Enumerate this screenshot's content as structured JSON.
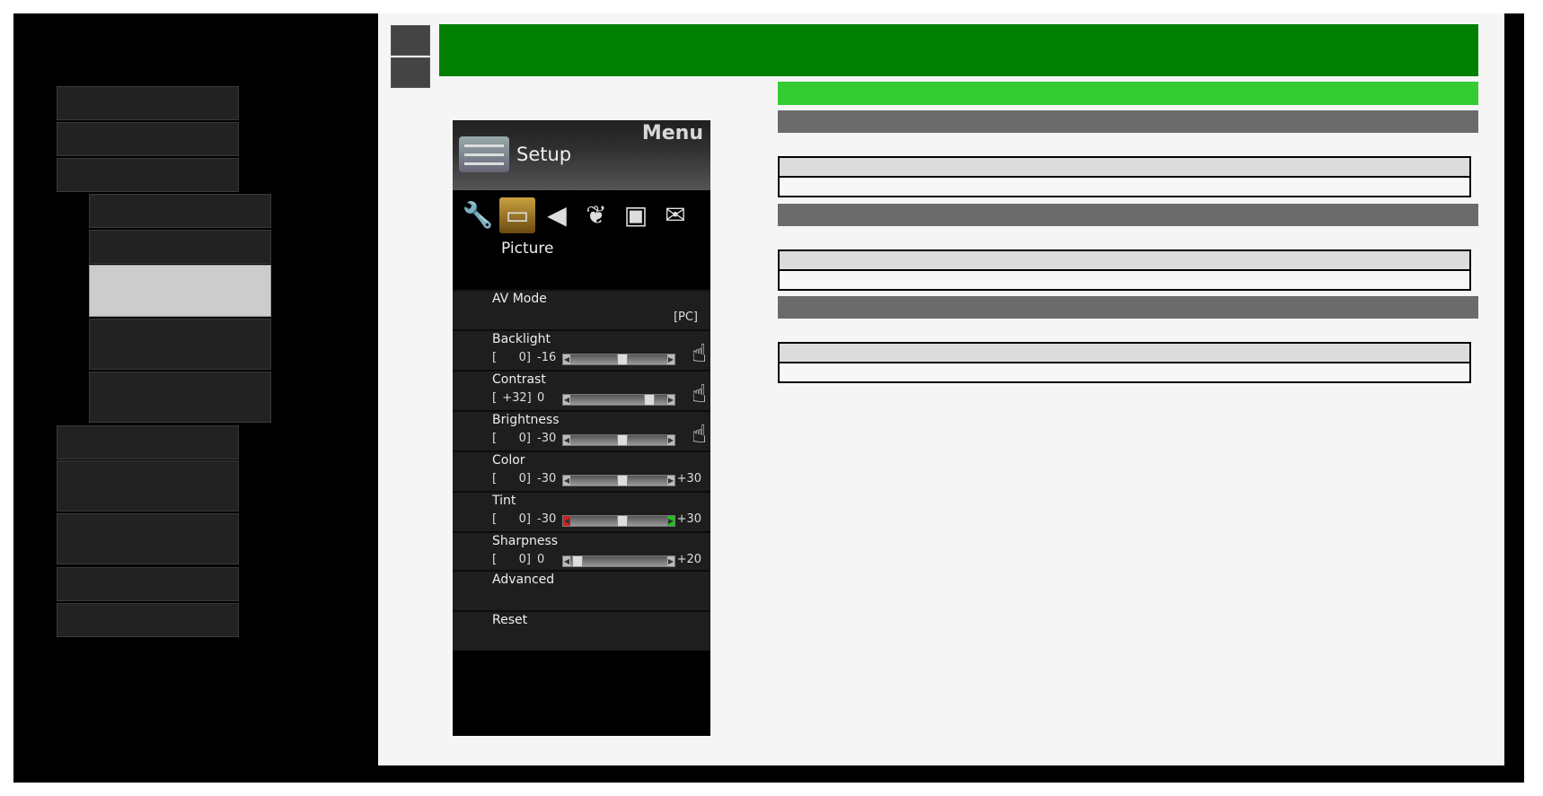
{
  "tv_menu": {
    "menu_title": "Menu",
    "setup_label": "Setup",
    "categories": [
      {
        "icon": "wrench-icon",
        "glyph": "🔧"
      },
      {
        "icon": "picture-icon",
        "glyph": "▭"
      },
      {
        "icon": "speaker-icon",
        "glyph": "◀"
      },
      {
        "icon": "leaf-icon",
        "glyph": "❦"
      },
      {
        "icon": "toolbox-icon",
        "glyph": "▣"
      },
      {
        "icon": "mail-icon",
        "glyph": "✉"
      }
    ],
    "category_label": "Picture",
    "av_mode": {
      "name": "AV Mode",
      "value": "[PC]"
    },
    "items": [
      {
        "name": "Backlight",
        "value": "[    0]",
        "min": "-16",
        "max": "",
        "level": 0.5,
        "hand": true
      },
      {
        "name": "Contrast",
        "value": "[ +32]",
        "min": "0",
        "max": "",
        "level": 0.8,
        "hand": true
      },
      {
        "name": "Brightness",
        "value": "[    0]",
        "min": "-30",
        "max": "",
        "level": 0.5,
        "hand": true
      },
      {
        "name": "Color",
        "value": "[    0]",
        "min": "-30",
        "max": "+30",
        "level": 0.5,
        "hand": false
      },
      {
        "name": "Tint",
        "value": "[    0]",
        "min": "-30",
        "max": "+30",
        "level": 0.5,
        "hand": false,
        "colored_ends": true
      },
      {
        "name": "Sharpness",
        "value": "[    0]",
        "min": "0",
        "max": "+20",
        "level": 0.0,
        "hand": false
      }
    ],
    "advanced": "Advanced",
    "reset": "Reset"
  }
}
